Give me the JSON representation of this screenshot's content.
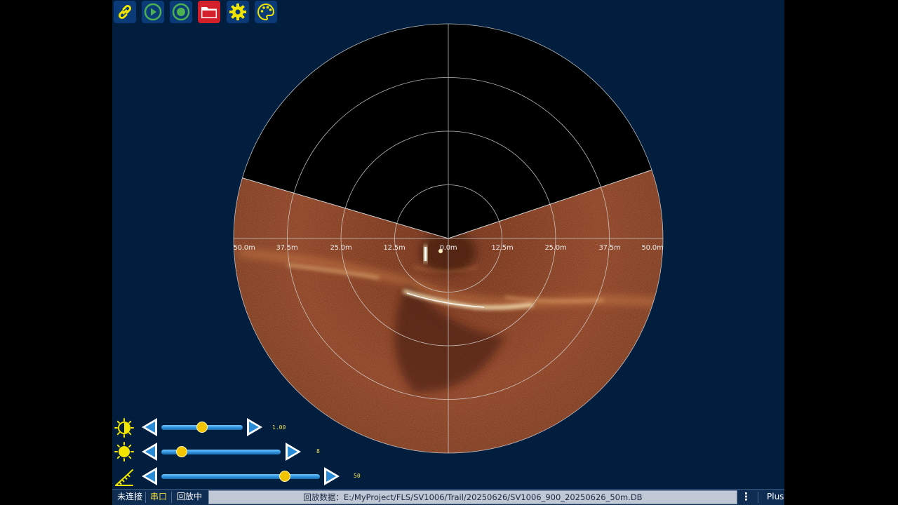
{
  "toolbar": {
    "buttons": [
      {
        "name": "link-icon",
        "bg": "#0a3a78"
      },
      {
        "name": "play-icon",
        "bg": "#0a3a78"
      },
      {
        "name": "record-icon",
        "bg": "#0a3a78"
      },
      {
        "name": "folder-icon",
        "bg": "#d4202a"
      },
      {
        "name": "gear-icon",
        "bg": "#0a3a78"
      },
      {
        "name": "palette-icon",
        "bg": "#0a3a78"
      }
    ]
  },
  "sonar": {
    "range_labels_left": [
      "50.0m",
      "37.5m",
      "25.0m",
      "12.5m"
    ],
    "center_label": "0.0m",
    "range_labels_right": [
      "12.5m",
      "25.0m",
      "37.5m",
      "50.0m"
    ],
    "colors": {
      "echo": "#8a3f22",
      "echo_bright": "#f7d690",
      "background": "#011e3e",
      "blind_sector": "#000000",
      "grid": "#d9d9d9"
    }
  },
  "controls": {
    "contrast": {
      "icon": "contrast-sun-icon",
      "value_text": "1.00",
      "level": 0.5
    },
    "brightness": {
      "icon": "sun-icon",
      "value_text": "8",
      "level": 0.12
    },
    "range": {
      "icon": "ruler-icon",
      "value_text": "50",
      "level": 0.77
    }
  },
  "statusbar": {
    "connection": "未连接",
    "port": "串口",
    "mode": "回放中",
    "path": "回放数据：E:/MyProject/FLS/SV1006/Trail/20250626/SV1006_900_20250626_50m.DB",
    "menu_icon": "more-vertical-icon",
    "edition": "Plus",
    "colors": {
      "port": "#f0e040",
      "text": "#ffffff"
    }
  }
}
